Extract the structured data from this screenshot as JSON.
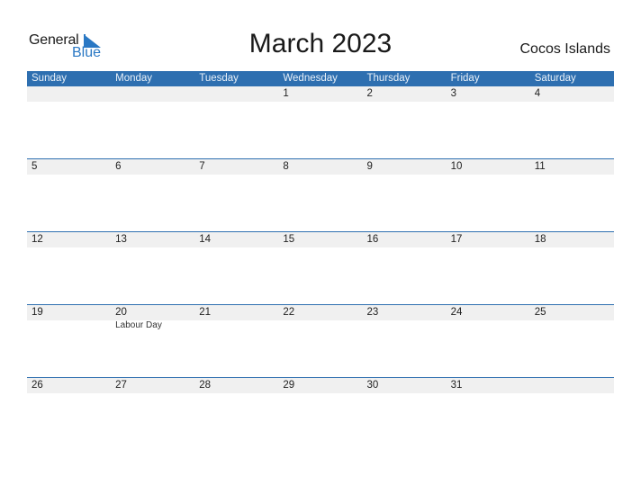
{
  "logo": {
    "text_top": "General",
    "text_bottom": "Blue",
    "icon": "triangle-flag-icon",
    "accent": "#2a78c4"
  },
  "title": "March 2023",
  "country": "Cocos Islands",
  "colors": {
    "header_bg": "#2e6fb0",
    "row_strip": "#f0f0f0"
  },
  "weekdays": [
    "Sunday",
    "Monday",
    "Tuesday",
    "Wednesday",
    "Thursday",
    "Friday",
    "Saturday"
  ],
  "weeks": [
    {
      "days": [
        {
          "num": "",
          "event": ""
        },
        {
          "num": "",
          "event": ""
        },
        {
          "num": "",
          "event": ""
        },
        {
          "num": "1",
          "event": ""
        },
        {
          "num": "2",
          "event": ""
        },
        {
          "num": "3",
          "event": ""
        },
        {
          "num": "4",
          "event": ""
        }
      ]
    },
    {
      "days": [
        {
          "num": "5",
          "event": ""
        },
        {
          "num": "6",
          "event": ""
        },
        {
          "num": "7",
          "event": ""
        },
        {
          "num": "8",
          "event": ""
        },
        {
          "num": "9",
          "event": ""
        },
        {
          "num": "10",
          "event": ""
        },
        {
          "num": "11",
          "event": ""
        }
      ]
    },
    {
      "days": [
        {
          "num": "12",
          "event": ""
        },
        {
          "num": "13",
          "event": ""
        },
        {
          "num": "14",
          "event": ""
        },
        {
          "num": "15",
          "event": ""
        },
        {
          "num": "16",
          "event": ""
        },
        {
          "num": "17",
          "event": ""
        },
        {
          "num": "18",
          "event": ""
        }
      ]
    },
    {
      "days": [
        {
          "num": "19",
          "event": ""
        },
        {
          "num": "20",
          "event": "Labour Day"
        },
        {
          "num": "21",
          "event": ""
        },
        {
          "num": "22",
          "event": ""
        },
        {
          "num": "23",
          "event": ""
        },
        {
          "num": "24",
          "event": ""
        },
        {
          "num": "25",
          "event": ""
        }
      ]
    },
    {
      "days": [
        {
          "num": "26",
          "event": ""
        },
        {
          "num": "27",
          "event": ""
        },
        {
          "num": "28",
          "event": ""
        },
        {
          "num": "29",
          "event": ""
        },
        {
          "num": "30",
          "event": ""
        },
        {
          "num": "31",
          "event": ""
        },
        {
          "num": "",
          "event": ""
        }
      ]
    }
  ]
}
